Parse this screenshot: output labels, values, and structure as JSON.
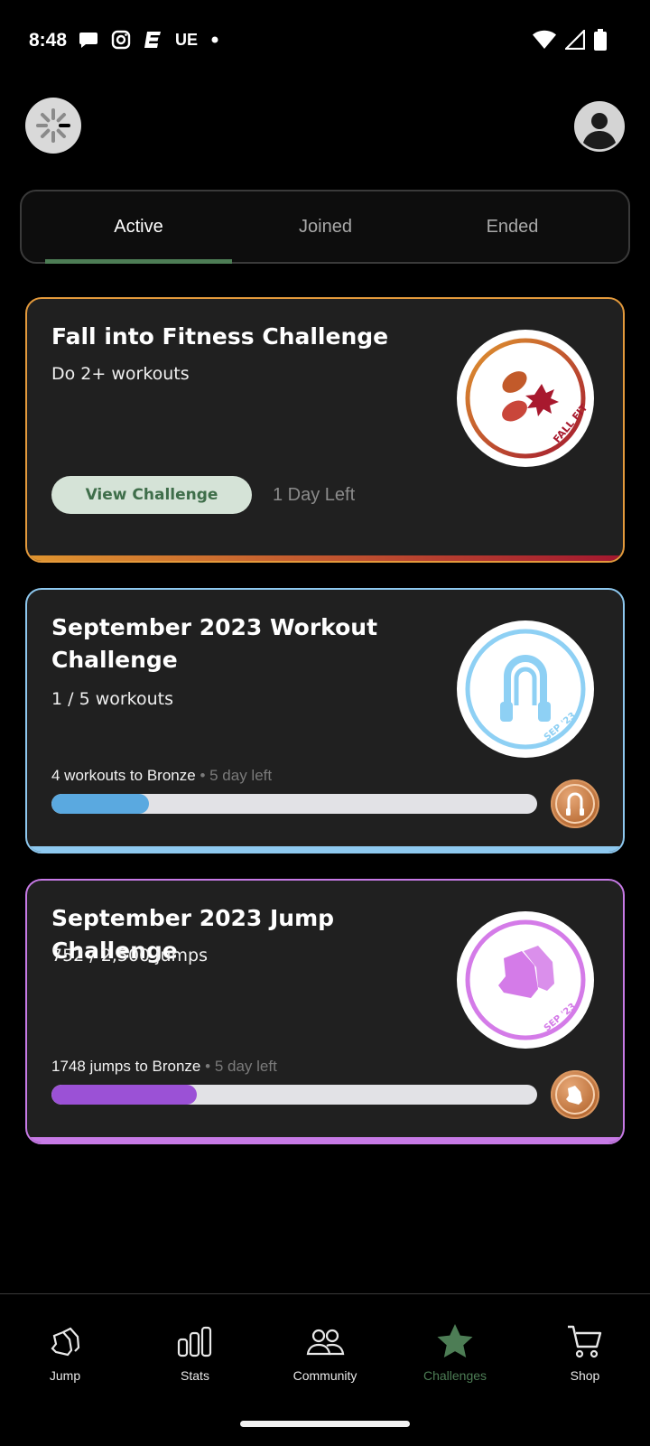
{
  "status": {
    "time": "8:48",
    "carrier_label": "UE"
  },
  "tabs": [
    {
      "label": "Active",
      "active": true
    },
    {
      "label": "Joined",
      "active": false
    },
    {
      "label": "Ended",
      "active": false
    }
  ],
  "challenges": [
    {
      "title": "Fall into Fitness Challenge",
      "subtitle": "Do 2+ workouts",
      "badge_text": "FALL FIT",
      "button_label": "View Challenge",
      "time_left": "1 Day Left",
      "border_color": "#e49a3c"
    },
    {
      "title": "September 2023 Workout Challenge",
      "subtitle": "1 / 5 workouts",
      "badge_text": "SEP '23",
      "progress_text": "4 workouts to Bronze",
      "progress_sep": "•",
      "progress_left": "5 day left",
      "progress_fraction": 0.2,
      "accent": "#5aa9e0",
      "border_color": "#8ec9f0"
    },
    {
      "title": "September 2023 Jump Challenge",
      "subtitle": "752 / 2,500 jumps",
      "badge_text": "SEP '23",
      "progress_text": "1748 jumps to Bronze",
      "progress_sep": "•",
      "progress_left": "5 day left",
      "progress_fraction": 0.3,
      "accent": "#9b51d6",
      "border_color": "#c77ae6"
    }
  ],
  "nav": [
    {
      "label": "Jump",
      "icon": "jump-shoes-icon",
      "active": false
    },
    {
      "label": "Stats",
      "icon": "stats-bars-icon",
      "active": false
    },
    {
      "label": "Community",
      "icon": "community-people-icon",
      "active": false
    },
    {
      "label": "Challenges",
      "icon": "star-icon",
      "active": true
    },
    {
      "label": "Shop",
      "icon": "shopping-cart-icon",
      "active": false
    }
  ],
  "colors": {
    "active_green": "#4d7d55",
    "card_bg": "#202020"
  }
}
